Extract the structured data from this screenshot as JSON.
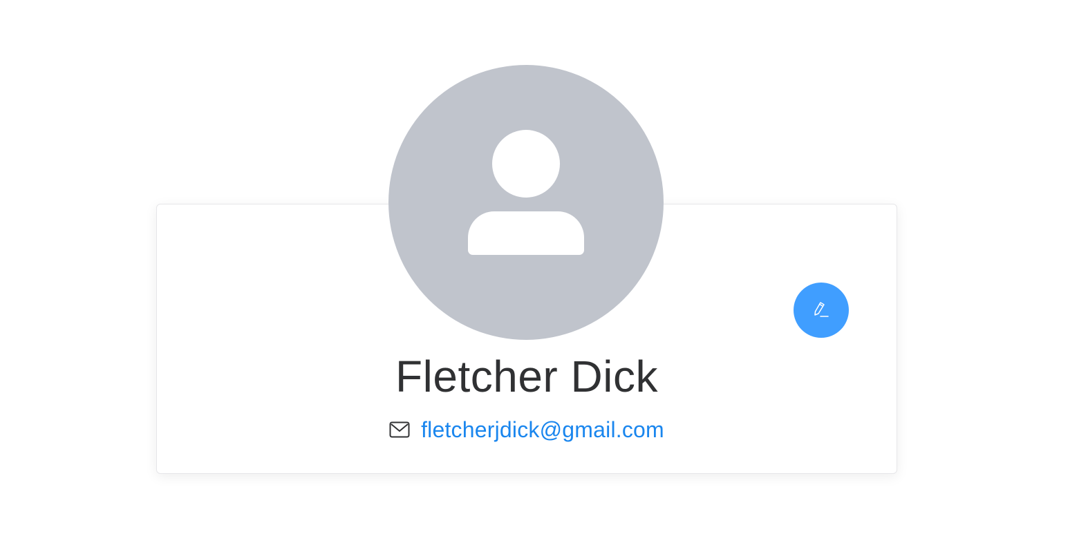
{
  "profile": {
    "name": "Fletcher Dick",
    "email": "fletcherjdick@gmail.com",
    "avatar_icon": "user-silhouette-icon",
    "mail_icon": "envelope-icon",
    "edit_icon": "pencil-icon"
  },
  "colors": {
    "avatar_background": "#c0c4cc",
    "accent": "#409eff",
    "link": "#1a86ee",
    "name_text": "#303133"
  }
}
